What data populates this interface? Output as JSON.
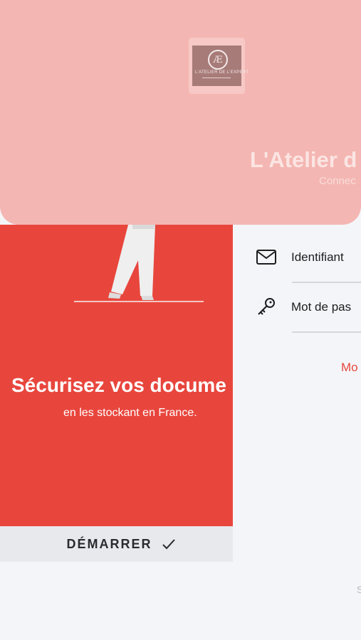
{
  "login": {
    "identifier_label": "Identifiant",
    "password_label": "Mot de pas",
    "forgot_link": "Mo",
    "bottom_hint": "S"
  },
  "header": {
    "app_title": "L'Atelier d",
    "subtitle": "Connec",
    "logo_text": "L'ATELIER DE L'EXPERT"
  },
  "onboarding": {
    "title": "Sécurisez vos docume",
    "subtitle": "en les stockant en France.",
    "start_button": "DÉMARRER"
  },
  "colors": {
    "accent": "#e8463d",
    "header_bg": "#f4b6b2",
    "page_bg": "#f4f5f8"
  }
}
